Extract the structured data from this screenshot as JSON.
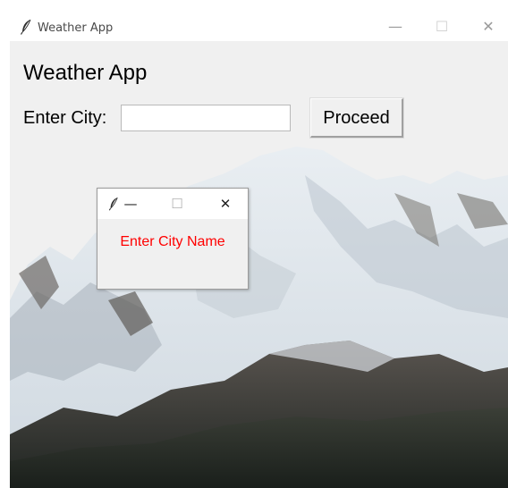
{
  "window": {
    "title": "Weather App",
    "controls": {
      "minimize": "—",
      "maximize": "☐",
      "close": "✕"
    }
  },
  "main": {
    "heading": "Weather App",
    "city_label": "Enter City:",
    "city_input_value": "",
    "proceed_label": "Proceed"
  },
  "popup": {
    "title": "",
    "controls": {
      "minimize": "—",
      "maximize": "☐",
      "close": "✕"
    },
    "message": "Enter City Name",
    "message_color": "#ff0000"
  },
  "icons": {
    "app_icon": "feather-icon",
    "background": "snowy-mountain-image"
  }
}
